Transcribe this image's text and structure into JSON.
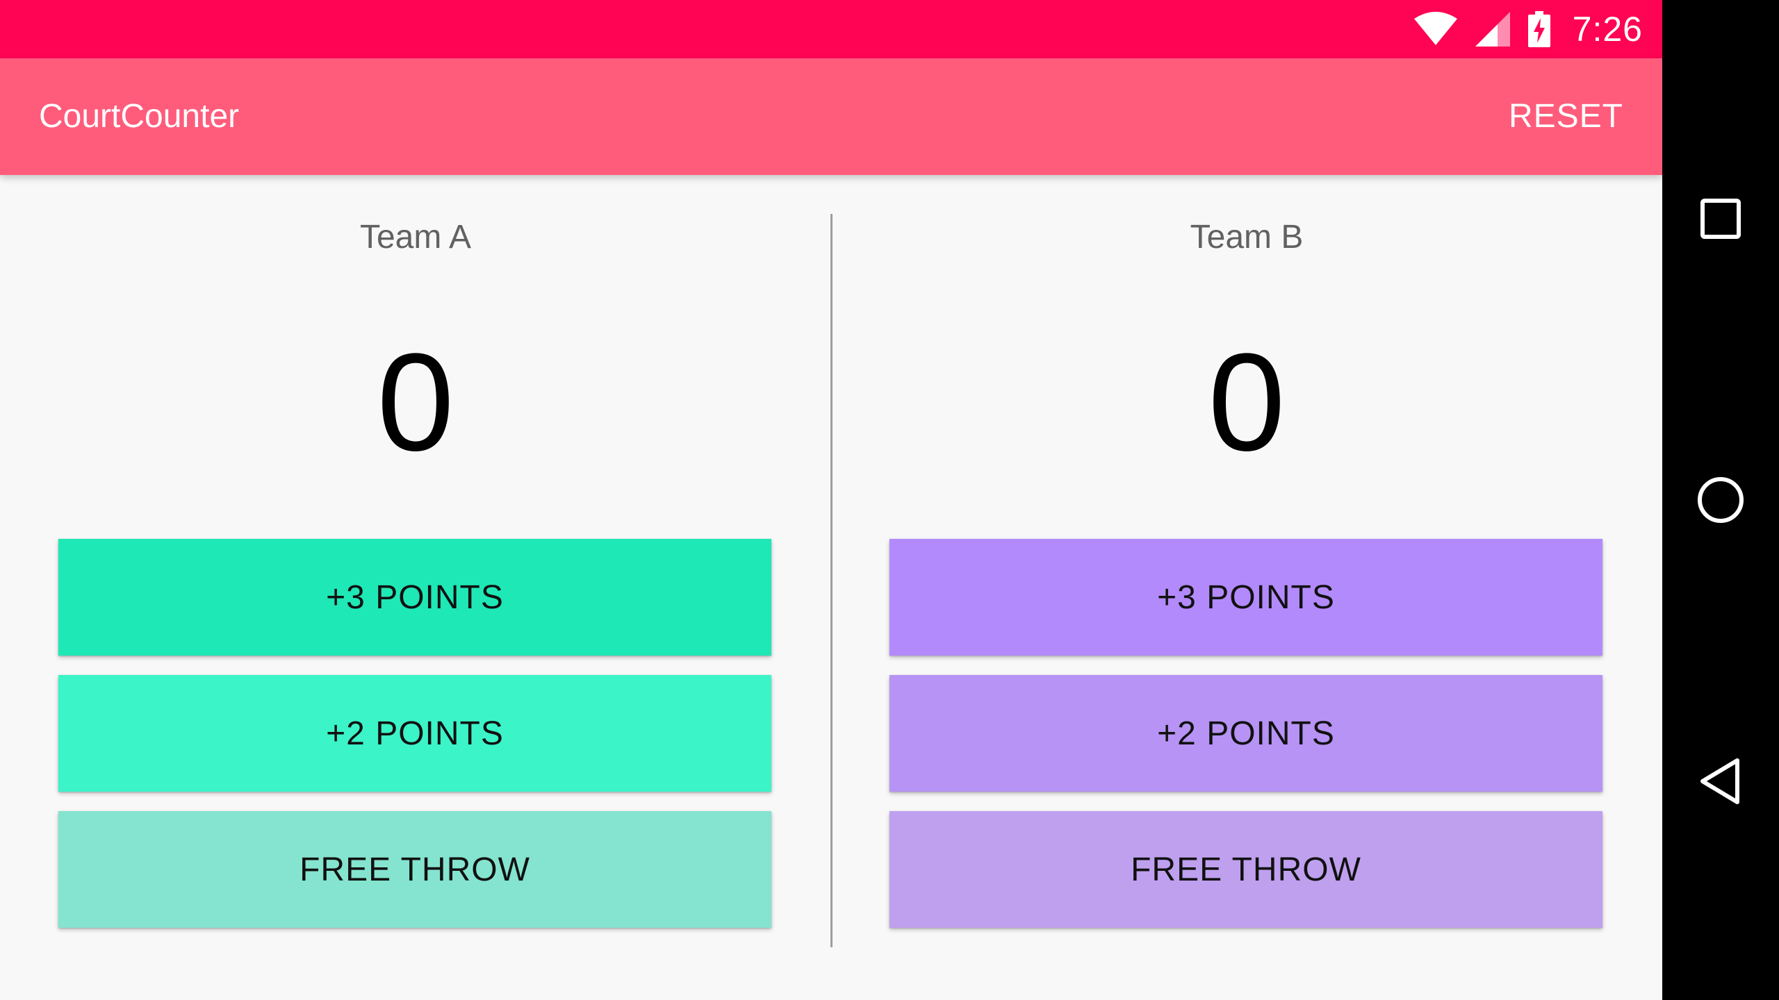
{
  "status_bar": {
    "time": "7:26",
    "background": "#ff0354",
    "icons": [
      "wifi-icon",
      "cell-signal-icon",
      "battery-charging-icon"
    ]
  },
  "app_bar": {
    "title": "CourtCounter",
    "reset_label": "RESET",
    "background": "#ff5c7c"
  },
  "teams": [
    {
      "name": "Team A",
      "score": "0",
      "buttons": [
        {
          "label": "+3 POINTS",
          "color": "#1ee8b6"
        },
        {
          "label": "+2 POINTS",
          "color": "#3bf4c8"
        },
        {
          "label": "FREE THROW",
          "color": "#84e4cf"
        }
      ]
    },
    {
      "name": "Team B",
      "score": "0",
      "buttons": [
        {
          "label": "+3 POINTS",
          "color": "#b38afc"
        },
        {
          "label": "+2 POINTS",
          "color": "#b693f5"
        },
        {
          "label": "FREE THROW",
          "color": "#bfa0ef"
        }
      ]
    }
  ],
  "nav_bar": {
    "icons": [
      "recents-icon",
      "home-icon",
      "back-icon"
    ]
  }
}
